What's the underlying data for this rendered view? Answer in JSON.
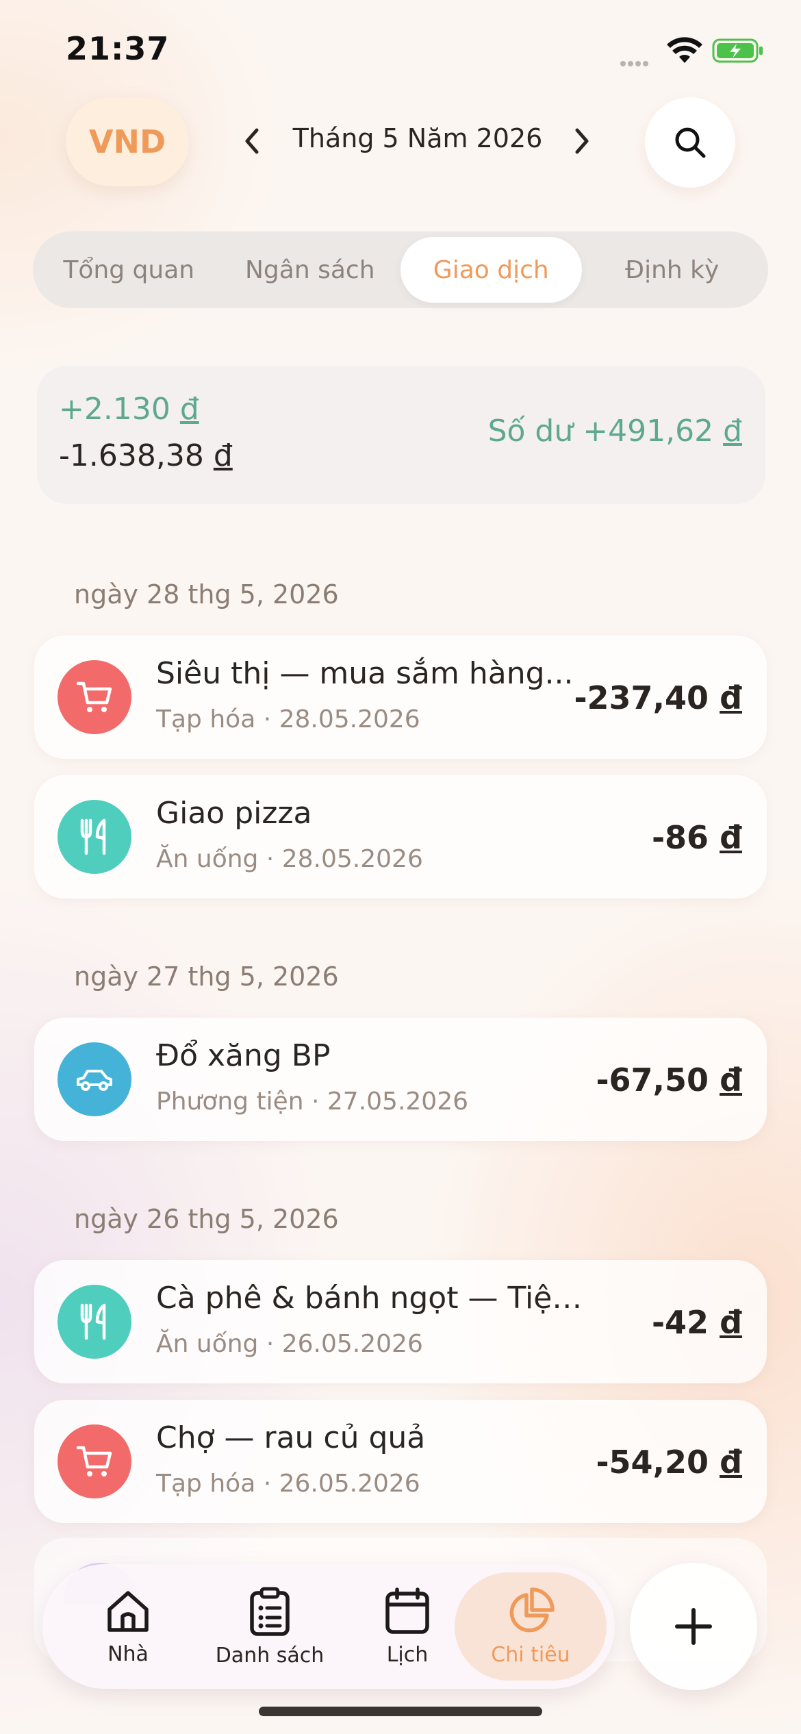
{
  "status_bar": {
    "time": "21:37"
  },
  "header": {
    "currency": "VND",
    "month_title": "Tháng 5 Năm 2026"
  },
  "tabs": [
    {
      "label": "Tổng quan",
      "active": false
    },
    {
      "label": "Ngân sách",
      "active": false
    },
    {
      "label": "Giao dịch",
      "active": true
    },
    {
      "label": "Định kỳ",
      "active": false
    }
  ],
  "summary": {
    "income": "+2.130",
    "expense": "-1.638,38",
    "balance_prefix": "Số dư +491,62",
    "currency_symbol": "đ"
  },
  "groups": [
    {
      "date": "ngày 28 thg 5, 2026",
      "transactions": [
        {
          "title": "Siêu thị — mua sắm hàng...",
          "subtitle": "Tạp hóa · 28.05.2026",
          "amount": "-237,40",
          "icon": "cart-icon",
          "color": "#f26a6a"
        },
        {
          "title": "Giao pizza",
          "subtitle": "Ăn uống · 28.05.2026",
          "amount": "-86",
          "icon": "fork-knife-icon",
          "color": "#4fcdbd"
        }
      ]
    },
    {
      "date": "ngày 27 thg 5, 2026",
      "transactions": [
        {
          "title": "Đổ xăng BP",
          "subtitle": "Phương tiện · 27.05.2026",
          "amount": "-67,50",
          "icon": "car-icon",
          "color": "#45b3d8"
        }
      ]
    },
    {
      "date": "ngày 26 thg 5, 2026",
      "transactions": [
        {
          "title": "Cà phê & bánh ngọt — Tiệm b...",
          "subtitle": "Ăn uống · 26.05.2026",
          "amount": "-42",
          "icon": "fork-knife-icon",
          "color": "#4fcdbd"
        },
        {
          "title": "Chợ — rau củ quả",
          "subtitle": "Tạp hóa · 26.05.2026",
          "amount": "-54,20",
          "icon": "cart-icon",
          "color": "#f26a6a"
        }
      ]
    }
  ],
  "tabbar": [
    {
      "label": "Nhà",
      "icon": "home-icon",
      "active": false
    },
    {
      "label": "Danh sách",
      "icon": "clipboard-list-icon",
      "active": false
    },
    {
      "label": "Lịch",
      "icon": "calendar-icon",
      "active": false
    },
    {
      "label": "Chi tiêu",
      "icon": "pie-chart-icon",
      "active": true
    }
  ],
  "colors": {
    "accent": "#f09a5a",
    "positive": "#5ea892",
    "grocery": "#f26a6a",
    "food": "#4fcdbd",
    "transport": "#45b3d8"
  }
}
